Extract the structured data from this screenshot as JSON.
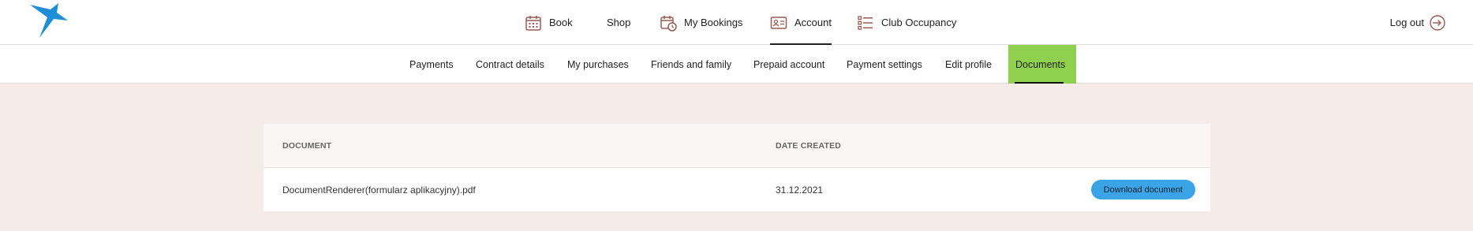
{
  "header": {
    "nav": [
      {
        "label": "Book",
        "icon": "calendar-icon"
      },
      {
        "label": "Shop",
        "icon": ""
      },
      {
        "label": "My Bookings",
        "icon": "calendar-clock-icon"
      },
      {
        "label": "Account",
        "icon": "id-card-icon"
      },
      {
        "label": "Club Occupancy",
        "icon": "list-icon"
      }
    ],
    "logout_label": "Log out",
    "active_nav": "Account"
  },
  "subnav": {
    "items": [
      {
        "label": "Payments"
      },
      {
        "label": "Contract details"
      },
      {
        "label": "My purchases"
      },
      {
        "label": "Friends and family"
      },
      {
        "label": "Prepaid account"
      },
      {
        "label": "Payment settings"
      },
      {
        "label": "Edit profile"
      },
      {
        "label": "Documents"
      }
    ],
    "active": "Documents"
  },
  "documents_table": {
    "columns": {
      "document": "DOCUMENT",
      "date_created": "DATE CREATED"
    },
    "rows": [
      {
        "document": "DocumentRenderer(formularz aplikacyjny).pdf",
        "date_created": "31.12.2021",
        "action_label": "Download document"
      }
    ]
  },
  "colors": {
    "page_bg": "#f5ebe9",
    "active_tab": "#8fd14f",
    "button": "#3aa4e6",
    "icon": "#9b5a52",
    "logo_blue": "#1e8fd6"
  }
}
